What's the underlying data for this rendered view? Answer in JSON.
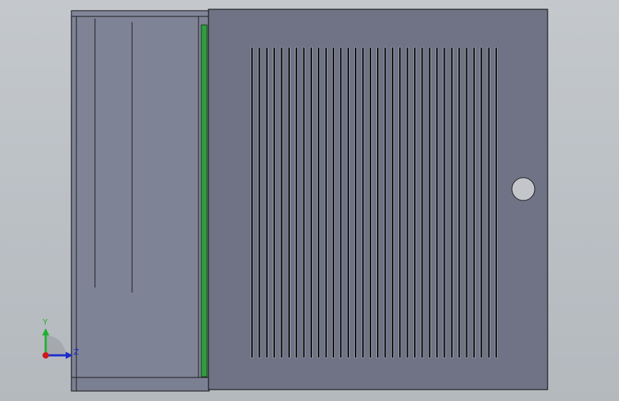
{
  "viewport": {
    "background_top": "#c4c8cc",
    "background_bottom": "#b4b9be"
  },
  "model": {
    "body_color": "#6f7385",
    "side_color": "#7e8396",
    "edge_color": "#1a1a1a",
    "gasket_color": "#2f9e3d",
    "slot_count": 34
  },
  "triad": {
    "y_label": "Y",
    "z_label": "Z",
    "y_color": "#20b030",
    "z_color": "#1a2ccc",
    "x_color": "#d01818"
  }
}
